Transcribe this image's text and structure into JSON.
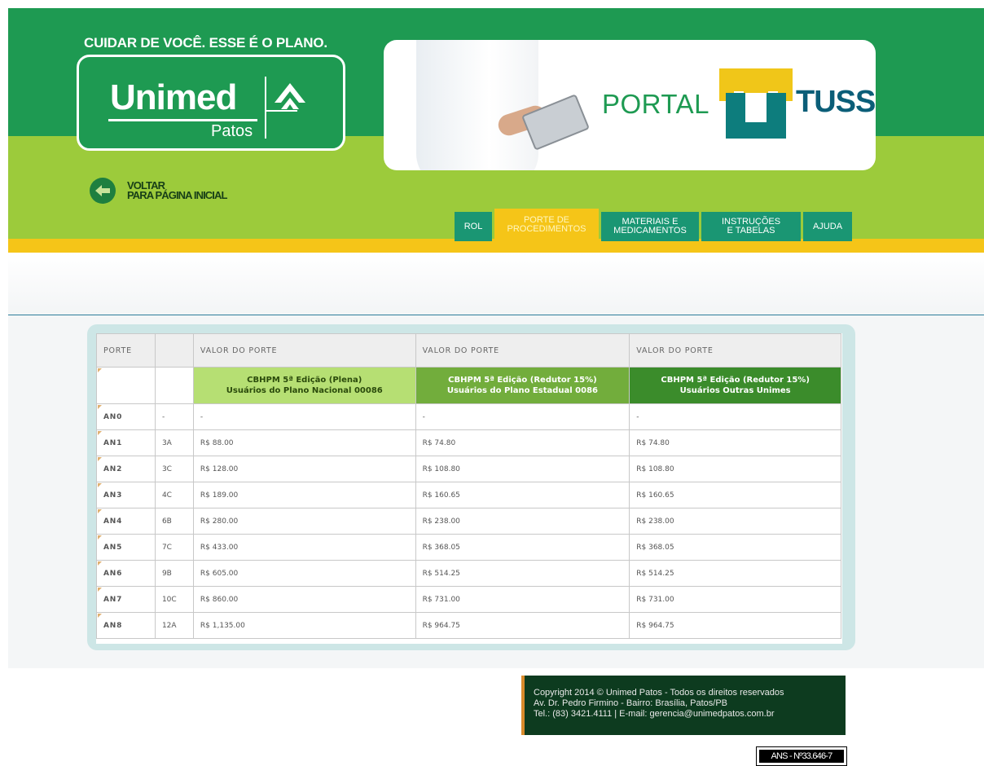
{
  "header": {
    "slogan": "CUIDAR DE VOCÊ. ESSE É O PLANO.",
    "logo_word": "Unimed",
    "logo_sub": "Patos",
    "back_line1": "VOLTAR",
    "back_line2": "PARA PÁGINA INICIAL",
    "banner_portal": "PORTAL",
    "banner_tuss": "TUSS",
    "colors": {
      "dark_green": "#1e9a52",
      "light_green": "#9ccb3b",
      "yellow": "#f5c518",
      "tab_teal": "#1a9673"
    }
  },
  "nav": {
    "items": [
      {
        "l1": "ROL",
        "l2": ""
      },
      {
        "l1": "PORTE DE",
        "l2": "PROCEDIMENTOS"
      },
      {
        "l1": "MATERIAIS E",
        "l2": "MEDICAMENTOS"
      },
      {
        "l1": "INSTRUÇÕES",
        "l2": "E TABELAS"
      },
      {
        "l1": "AJUDA",
        "l2": ""
      }
    ],
    "active": "PORTE DE PROCEDIMENTOS"
  },
  "table": {
    "headers": [
      "PORTE",
      "",
      "VALOR DO PORTE",
      "VALOR DO PORTE",
      "VALOR DO PORTE"
    ],
    "subheaders": [
      {
        "l1": "CBHPM 5ª Edição (Plena)",
        "l2": "Usuários do Plano Nacional 00086"
      },
      {
        "l1": "CBHPM 5ª Edição (Redutor 15%)",
        "l2": "Usuários do Plano Estadual 0086"
      },
      {
        "l1": "CBHPM 5ª Edição (Redutor 15%)",
        "l2": "Usuários Outras Unimes"
      }
    ],
    "rows": [
      [
        "AN0",
        "-",
        "-",
        "-",
        "-"
      ],
      [
        "AN1",
        "3A",
        "R$ 88.00",
        "R$ 74.80",
        "R$ 74.80"
      ],
      [
        "AN2",
        "3C",
        "R$ 128.00",
        "R$ 108.80",
        "R$ 108.80"
      ],
      [
        "AN3",
        "4C",
        "R$ 189.00",
        "R$ 160.65",
        "R$ 160.65"
      ],
      [
        "AN4",
        "6B",
        "R$ 280.00",
        "R$ 238.00",
        "R$ 238.00"
      ],
      [
        "AN5",
        "7C",
        "R$ 433.00",
        "R$ 368.05",
        "R$ 368.05"
      ],
      [
        "AN6",
        "9B",
        "R$ 605.00",
        "R$ 514.25",
        "R$ 514.25"
      ],
      [
        "AN7",
        "10C",
        "R$ 860.00",
        "R$ 731.00",
        "R$ 731.00"
      ],
      [
        "AN8",
        "12A",
        "R$ 1,135.00",
        "R$ 964.75",
        "R$ 964.75"
      ]
    ]
  },
  "footer": {
    "line1": "Copyright 2014 © Unimed Patos - Todos os direitos reservados",
    "line2": "Av. Dr. Pedro Firmino - Bairro: Brasília, Patos/PB",
    "line3": "Tel.: (83) 3421.4111 | E-mail: gerencia@unimedpatos.com.br",
    "ans": "ANS - Nº33.646-7"
  }
}
